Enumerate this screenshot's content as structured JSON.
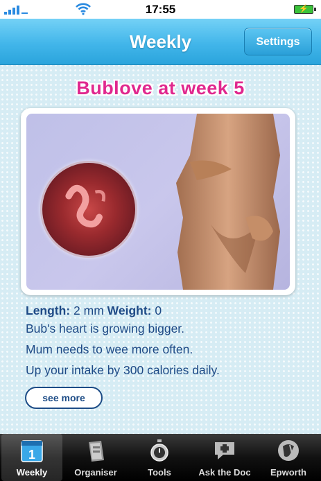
{
  "status_bar": {
    "time": "17:55"
  },
  "nav": {
    "title": "Weekly",
    "settings_label": "Settings"
  },
  "content": {
    "heading": "Bublove at week 5",
    "length_label": "Length:",
    "length_value": "2 mm",
    "weight_label": "Weight:",
    "weight_value": "0",
    "facts": [
      "Bub's heart is growing bigger.",
      "Mum needs to wee more often.",
      "Up your intake by 300 calories daily."
    ],
    "see_more_label": "see more"
  },
  "tabs": [
    {
      "label": "Weekly",
      "icon": "calendar-icon",
      "active": true
    },
    {
      "label": "Organiser",
      "icon": "organiser-icon",
      "active": false
    },
    {
      "label": "Tools",
      "icon": "stopwatch-icon",
      "active": false
    },
    {
      "label": "Ask the Doc",
      "icon": "chat-plus-icon",
      "active": false
    },
    {
      "label": "Epworth",
      "icon": "epworth-logo-icon",
      "active": false
    }
  ],
  "colors": {
    "accent": "#42b6ea",
    "heading": "#e0288e",
    "text": "#1e4a86"
  }
}
